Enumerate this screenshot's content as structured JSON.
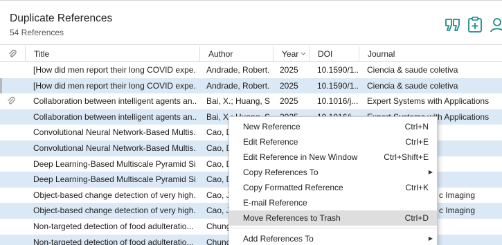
{
  "header": {
    "title": "Duplicate References",
    "subtitle": "54 References",
    "icons": [
      "quote-icon",
      "clipboard-add-icon",
      "user-icon"
    ],
    "accent_color": "#1a8b8b"
  },
  "columns": {
    "attach": "paperclip-icon",
    "title": "Title",
    "author": "Author",
    "year": "Year",
    "year_sort": "chevron-down-icon",
    "doi": "DOI",
    "journal": "Journal"
  },
  "rows": [
    {
      "attach": false,
      "title": "[How did men report their long COVID expe...",
      "author": "Andrade, Robert...",
      "year": "2025",
      "doi": "10.1590/1...",
      "journal": "Ciencia & saude coletiva"
    },
    {
      "attach": false,
      "title": "[How did men report their long COVID expe...",
      "author": "Andrade, Robert...",
      "year": "2025",
      "doi": "10.1590/1...",
      "journal": "Ciencia & saude coletiva"
    },
    {
      "attach": true,
      "title": "Collaboration between intelligent agents an...",
      "author": "Bai, X.; Huang, S....",
      "year": "2025",
      "doi": "10.1016/j....",
      "journal": "Expert Systems with Applications"
    },
    {
      "attach": false,
      "title": "Collaboration between intelligent agents an...",
      "author": "Bai, X.; Huang, S....",
      "year": "2025",
      "doi": "10.1016/j....",
      "journal": "Expert Systems with Applications"
    },
    {
      "attach": false,
      "title": "Convolutional Neural Network-Based Multis...",
      "author": "Cao, D",
      "year": "",
      "doi": "",
      "journal": ""
    },
    {
      "attach": false,
      "title": "Convolutional Neural Network-Based Multis...",
      "author": "Cao, D",
      "year": "",
      "doi": "",
      "journal": ""
    },
    {
      "attach": false,
      "title": "Deep Learning-Based Multiscale Pyramid Si...",
      "author": "Cao, D",
      "year": "",
      "doi": "",
      "journal": ""
    },
    {
      "attach": false,
      "title": "Deep Learning-Based Multiscale Pyramid Si...",
      "author": "Cao, D",
      "year": "",
      "doi": "",
      "journal": ""
    },
    {
      "attach": false,
      "title": "Object-based change detection of very high...",
      "author": "Cao, J.",
      "year": "",
      "doi": "",
      "journal": "c Imaging"
    },
    {
      "attach": false,
      "title": "Object-based change detection of very high...",
      "author": "Cao, J.",
      "year": "",
      "doi": "",
      "journal": "c Imaging"
    },
    {
      "attach": false,
      "title": "Non-targeted detection of food adulteratio...",
      "author": "Chung",
      "year": "",
      "doi": "",
      "journal": ""
    },
    {
      "attach": false,
      "title": "Non-targeted detection of food adulteratio...",
      "author": "Chung",
      "year": "",
      "doi": "",
      "journal": ""
    }
  ],
  "context_menu": {
    "items": [
      {
        "label": "New Reference",
        "shortcut": "Ctrl+N"
      },
      {
        "label": "Edit Reference",
        "shortcut": "Ctrl+E"
      },
      {
        "label": "Edit Reference in New Window",
        "shortcut": "Ctrl+Shift+E"
      },
      {
        "label": "Copy References To",
        "shortcut": "",
        "submenu": true
      },
      {
        "label": "Copy Formatted Reference",
        "shortcut": "Ctrl+K"
      },
      {
        "label": "E-mail Reference",
        "shortcut": ""
      },
      {
        "label": "Move References to Trash",
        "shortcut": "Ctrl+D",
        "highlighted": true
      },
      {
        "label": "Add References To",
        "shortcut": "",
        "submenu": true
      }
    ]
  }
}
